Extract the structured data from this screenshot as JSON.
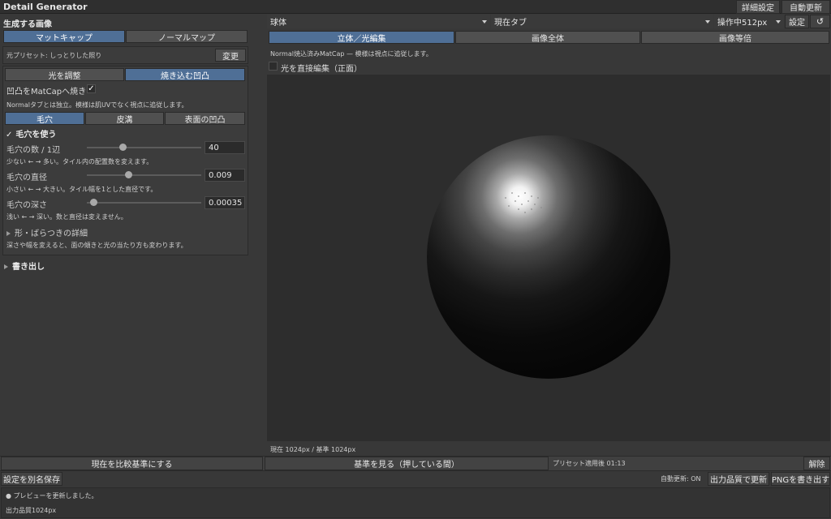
{
  "window": {
    "title": "Detail Generator"
  },
  "top_right": {
    "advanced_label": "詳細設定",
    "auto_update_label": "自動更新"
  },
  "left": {
    "generate_heading": "生成する画像",
    "tabs": [
      "マットキャップ",
      "ノーマルマップ"
    ],
    "preset_text": "元プリセット: しっとりした照り",
    "change_label": "変更",
    "mode_tabs": [
      "光を調整",
      "焼き込む凹凸"
    ],
    "bake_label": "凹凸をMatCapへ焼き込む",
    "bake_note": "Normalタブとは独立。模様は肌UVでなく視点に追従します。",
    "detail_tabs": [
      "毛穴",
      "皮溝",
      "表面の凹凸"
    ],
    "use_pores_label": "毛穴を使う",
    "sliders": [
      {
        "label": "毛穴の数 / 1辺",
        "value": "40",
        "note": "少ない ← → 多い。タイル内の配置数を変えます。",
        "level": 0.3
      },
      {
        "label": "毛穴の直径",
        "value": "0.009",
        "note": "小さい ← → 大きい。タイル幅を1とした直径です。",
        "level": 0.36
      },
      {
        "label": "毛穴の深さ",
        "value": "0.00035",
        "note": "浅い ← → 深い。数と直径は変えません。",
        "level": 0.05
      }
    ],
    "shape_details_label": "形・ばらつきの詳細",
    "shape_note": "深さや幅を変えると、面の傾きと光の当たり方も変わります。",
    "export_label": "書き出し"
  },
  "toolbar": {
    "shape_select": "球体",
    "tab_select": "現在タブ",
    "size_select": "操作中512px",
    "settings_label": "設定",
    "refresh_icon": "refresh-icon"
  },
  "view_tabs": [
    "立体／光編集",
    "画像全体",
    "画像等倍"
  ],
  "preview_note": "Normal焼込済みMatCap — 模様は視点に追従します。",
  "direct_edit_label": "光を直接編集（正面）",
  "size_status": "現在 1024px / 基準 1024px",
  "bottom": {
    "set_baseline_label": "現在を比較基準にする",
    "view_baseline_label": "基準を見る（押している間）",
    "preset_applied": "プリセット適用後 01:13",
    "release_label": "解除",
    "save_as_label": "設定を別名保存",
    "auto_status": "自動更新: ON",
    "update_quality_label": "出力品質で更新",
    "export_png_label": "PNGを書き出す",
    "log_line1": "● プレビューを更新しました。",
    "log_line2": "出力品質1024px"
  },
  "colors": {
    "accent": "#4f6f96",
    "background": "#383838",
    "viewport": "#2d2d2d"
  }
}
